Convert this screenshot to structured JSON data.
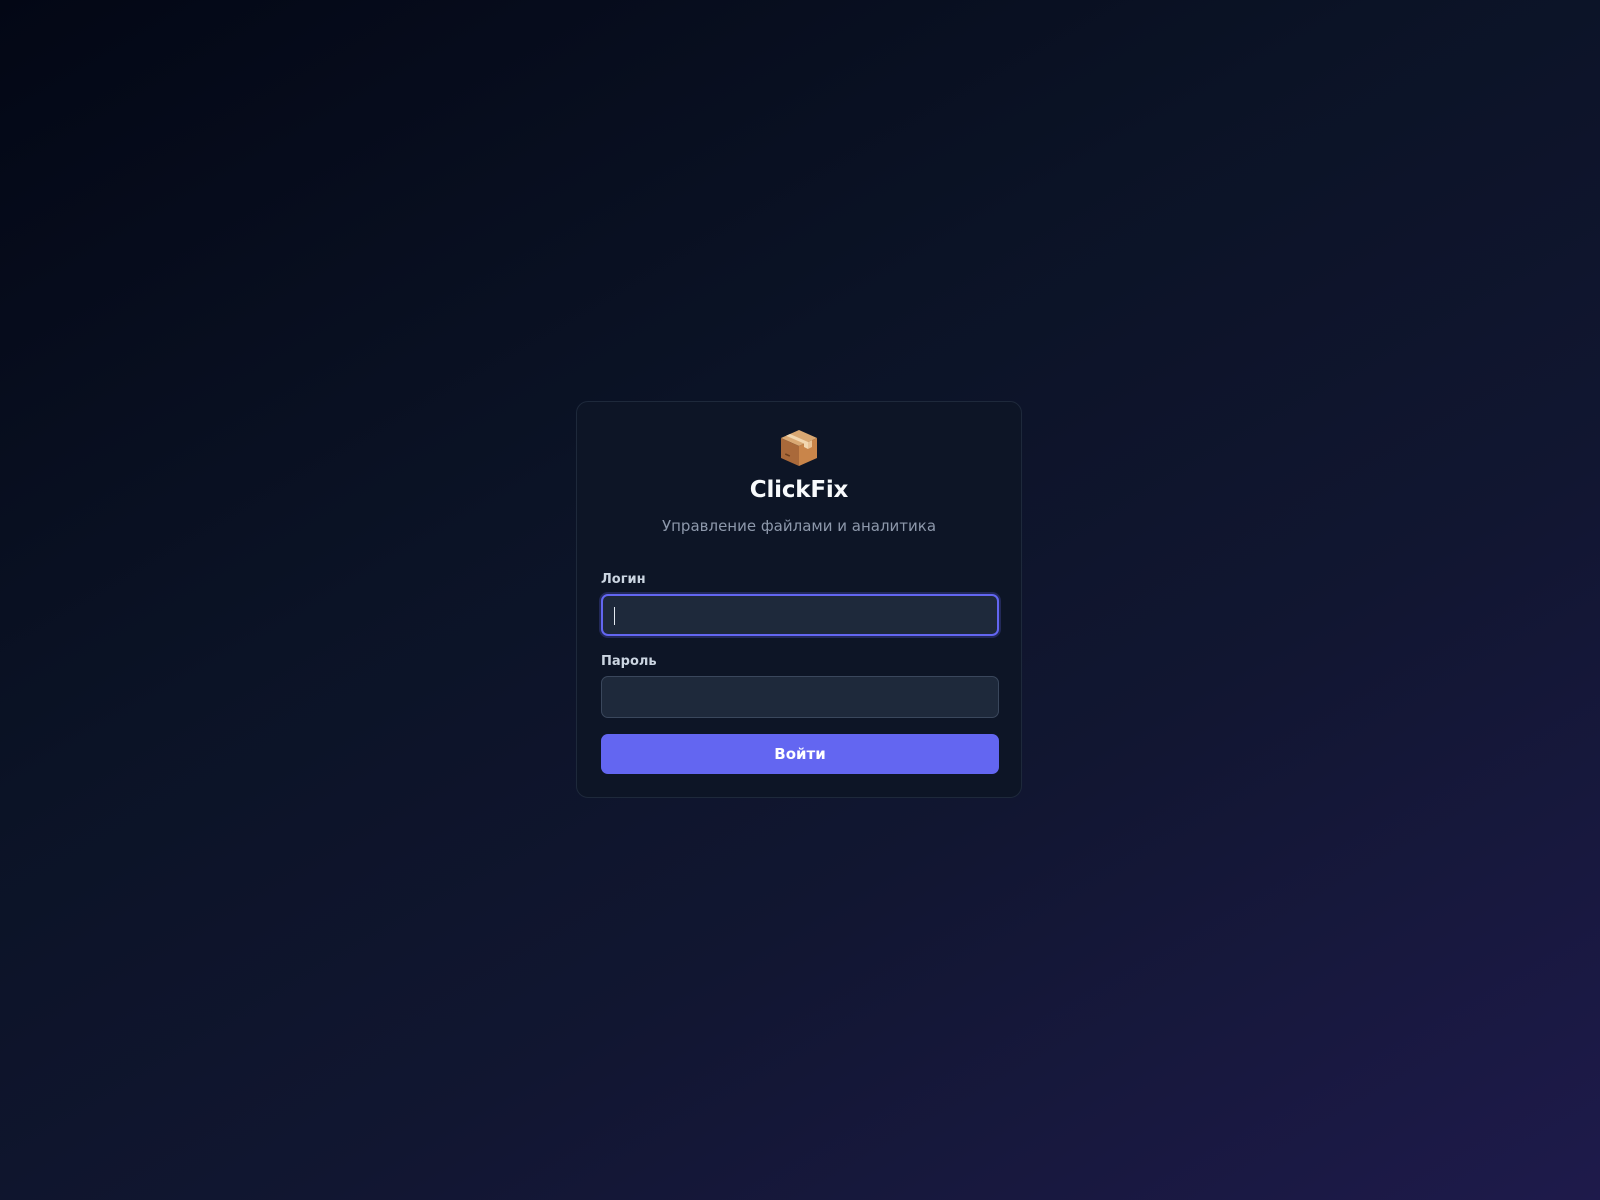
{
  "app": {
    "logo_icon": "package-icon",
    "name": "ClickFix",
    "tagline": "Управление файлами и аналитика"
  },
  "form": {
    "login": {
      "label": "Логин",
      "value": "",
      "placeholder": ""
    },
    "password": {
      "label": "Пароль",
      "value": "",
      "placeholder": ""
    },
    "submit_label": "Войти"
  },
  "colors": {
    "accent": "#6366f1",
    "card_background": "#0d1526",
    "input_background": "#1e293b",
    "page_background_start": "#030715",
    "page_background_end": "#1e1a4b"
  }
}
